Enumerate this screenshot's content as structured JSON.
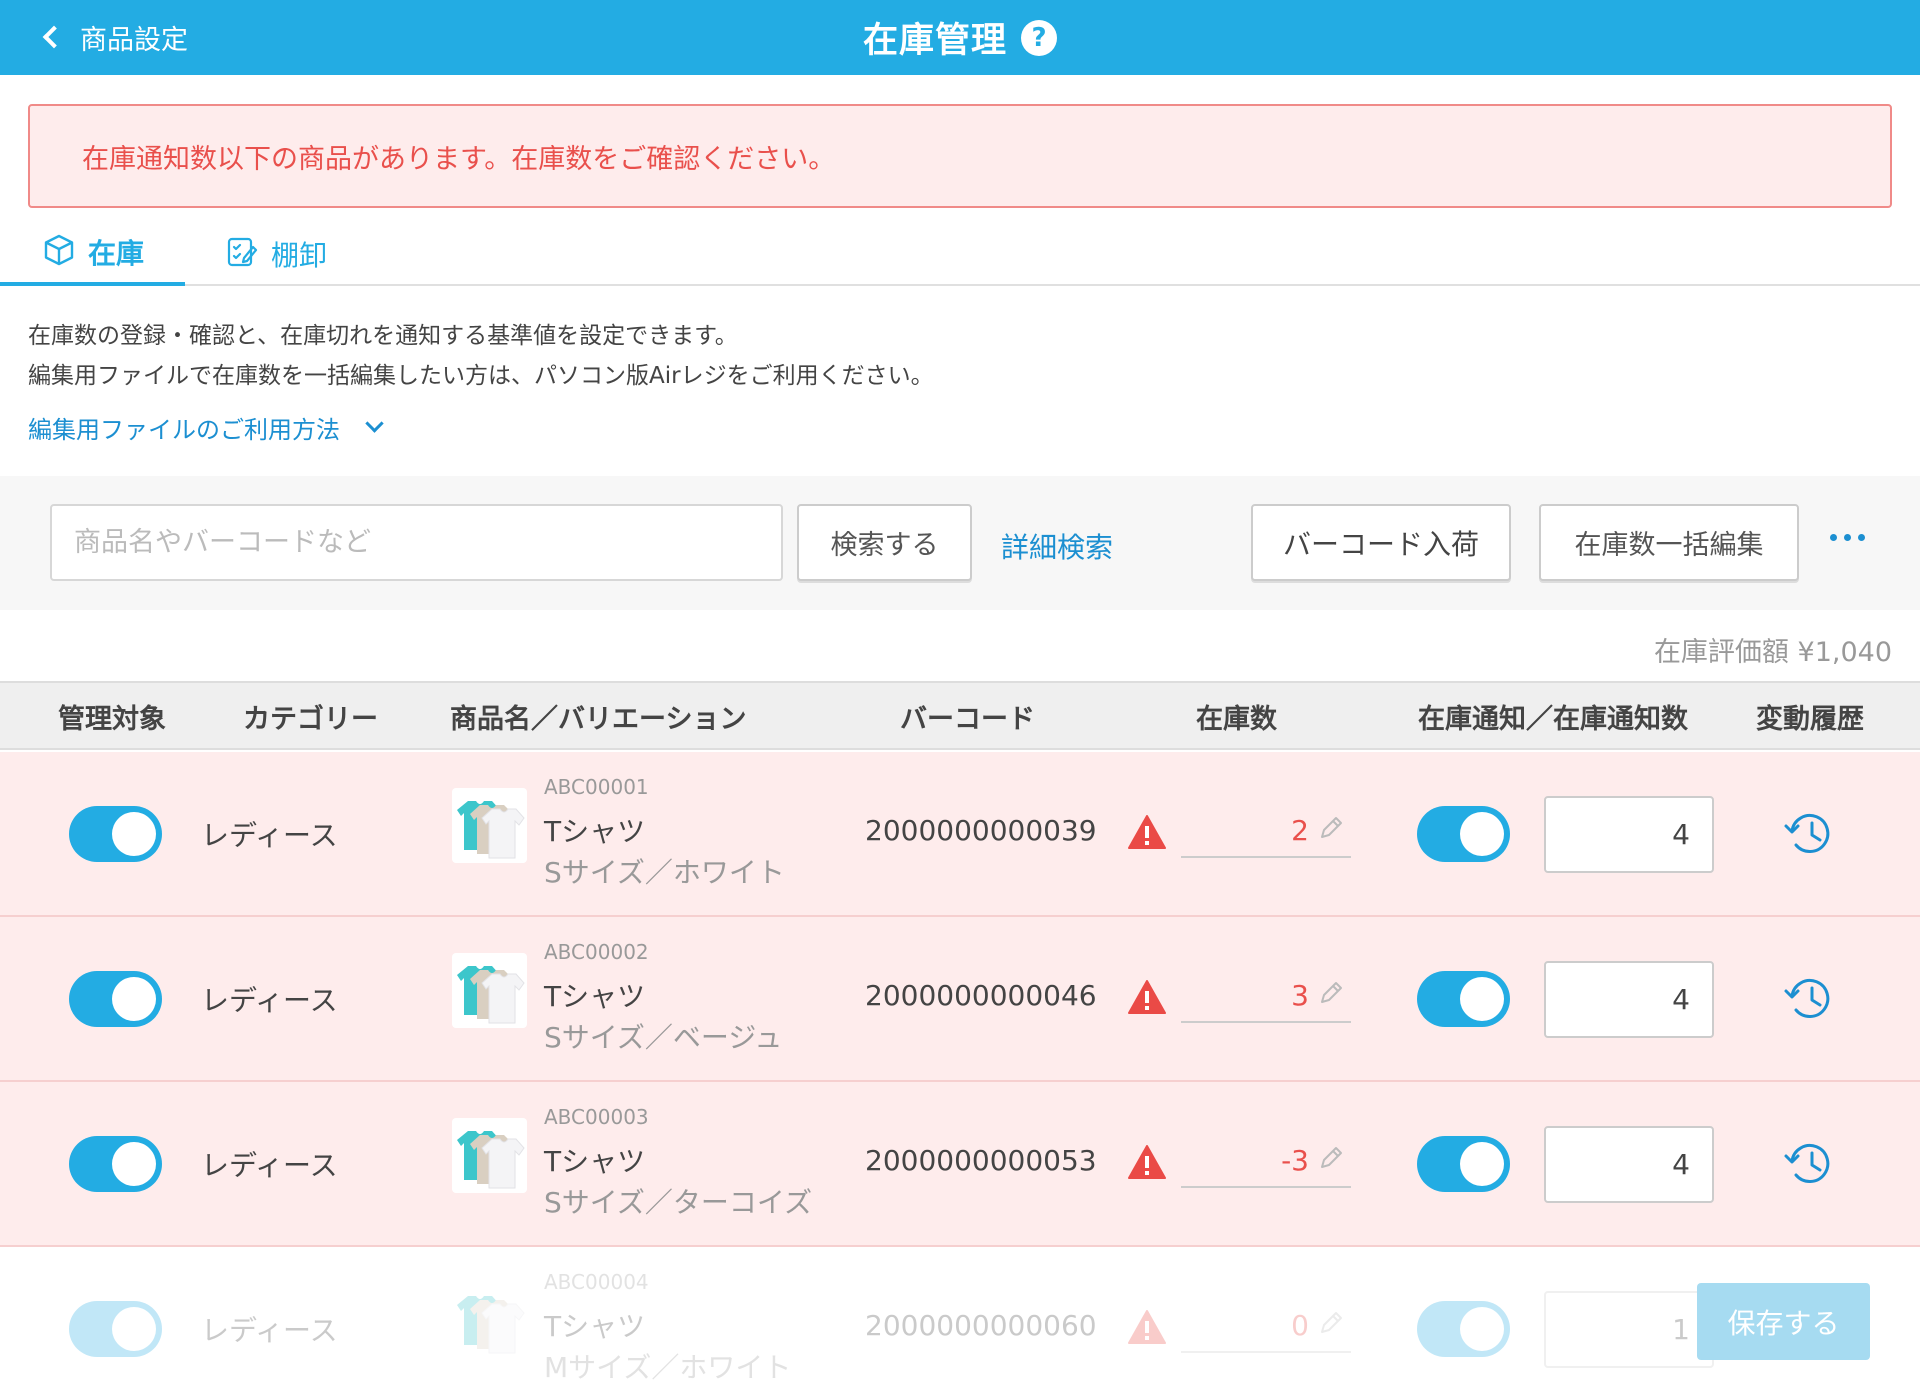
{
  "header": {
    "back_label": "商品設定",
    "title": "在庫管理",
    "help": "?"
  },
  "alert": {
    "message": "在庫通知数以下の商品があります。在庫数をご確認ください。"
  },
  "tabs": [
    {
      "label": "在庫"
    },
    {
      "label": "棚卸"
    }
  ],
  "description": {
    "line1": "在庫数の登録・確認と、在庫切れを通知する基準値を設定できます。",
    "line2": "編集用ファイルで在庫数を一括編集したい方は、パソコン版Airレジをご利用ください。",
    "howto_link": "編集用ファイルのご利用方法"
  },
  "search": {
    "placeholder": "商品名やバーコードなど",
    "search_button": "検索する",
    "advanced_link": "詳細検索",
    "barcode_button": "バーコード入荷",
    "bulk_button": "在庫数一括編集"
  },
  "valuation": "在庫評価額 ¥1,040",
  "table": {
    "headers": [
      "管理対象",
      "カテゴリー",
      "商品名／バリエーション",
      "バーコード",
      "在庫数",
      "在庫通知／在庫通知数",
      "変動履歴"
    ],
    "rows": [
      {
        "category": "レディース",
        "sku": "ABC00001",
        "name": "Tシャツ",
        "variant": "Sサイズ／ホワイト",
        "barcode": "2000000000039",
        "stock": "2",
        "notify_qty": "4",
        "managed": true,
        "notify": true
      },
      {
        "category": "レディース",
        "sku": "ABC00002",
        "name": "Tシャツ",
        "variant": "Sサイズ／ベージュ",
        "barcode": "2000000000046",
        "stock": "3",
        "notify_qty": "4",
        "managed": true,
        "notify": true
      },
      {
        "category": "レディース",
        "sku": "ABC00003",
        "name": "Tシャツ",
        "variant": "Sサイズ／ターコイズ",
        "barcode": "2000000000053",
        "stock": "-3",
        "notify_qty": "4",
        "managed": true,
        "notify": true
      },
      {
        "category": "レディース",
        "sku": "ABC00004",
        "name": "Tシャツ",
        "variant": "Mサイズ／ホワイト",
        "barcode": "2000000000060",
        "stock": "0",
        "notify_qty": "1",
        "managed": true,
        "notify": true
      }
    ]
  },
  "save_button": "保存する",
  "colors": {
    "brand": "#23ace3",
    "alert_text": "#e9504c",
    "alert_bg": "#feecec",
    "link": "#1c8fd1"
  },
  "icons": [
    "chevron-left-icon",
    "help-icon",
    "box-icon",
    "checklist-icon",
    "chevron-down-icon",
    "more-icon",
    "warning-icon",
    "pencil-icon",
    "history-icon",
    "tshirt-thumbnail"
  ]
}
